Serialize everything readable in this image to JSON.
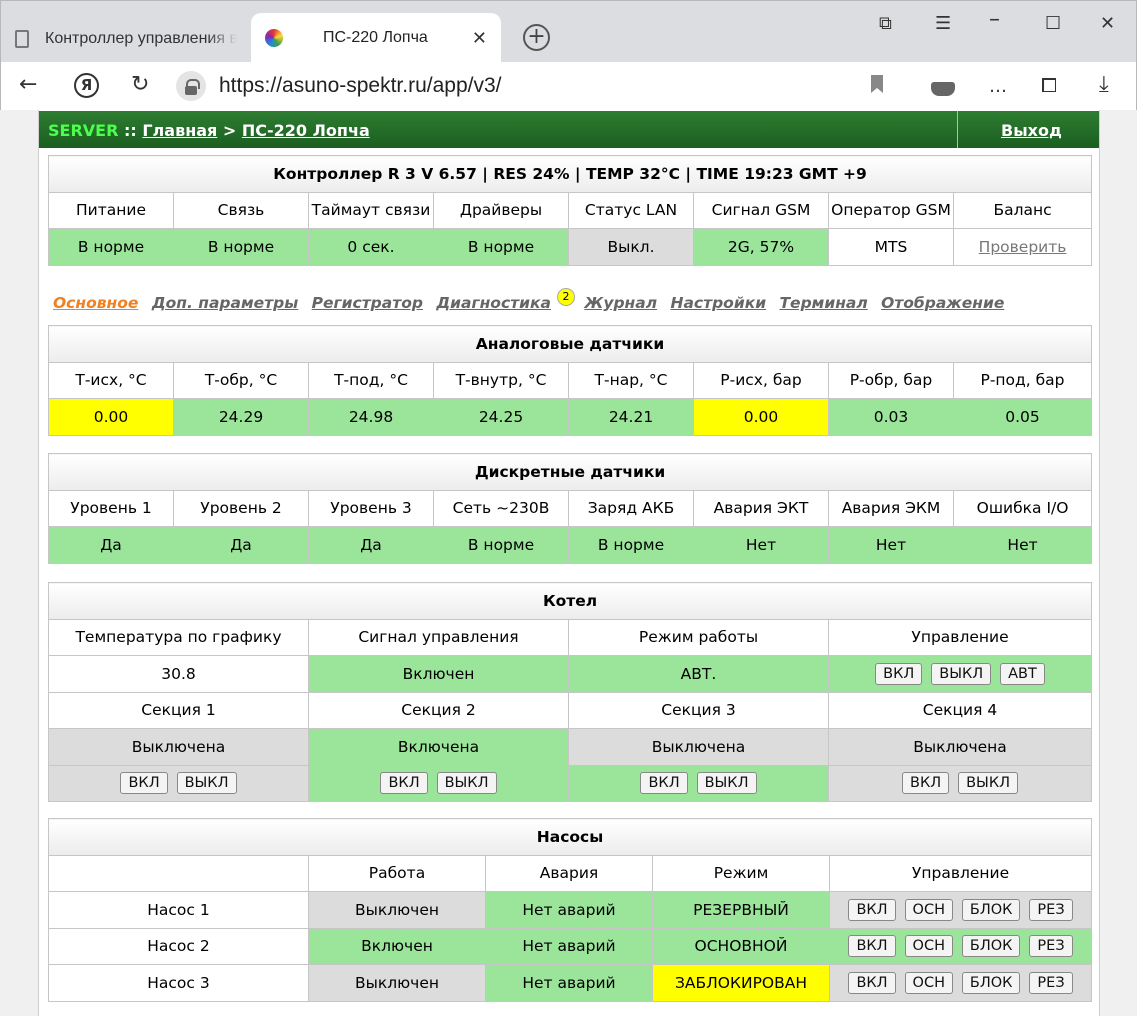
{
  "browser": {
    "tab_inactive_title": "Контроллер управления в",
    "tab_active_title": "ПС-220 Лопча",
    "url": "https://asuno-spektr.ru/app/v3/"
  },
  "nav": {
    "server": "SERVER",
    "separator": "::",
    "home": "Главная",
    "arrow": ">",
    "object": "ПС-220 Лопча",
    "logout": "Выход"
  },
  "controller": {
    "header": "Контроллер R 3 V 6.57 | RES 24% | TEMP 32°C | TIME 19:23 GMT +9",
    "columns": [
      "Питание",
      "Связь",
      "Таймаут связи",
      "Драйверы",
      "Статус LAN",
      "Сигнал GSM",
      "Оператор GSM",
      "Баланс"
    ],
    "values": [
      "В норме",
      "В норме",
      "0 сек.",
      "В норме",
      "Выкл.",
      "2G, 57%",
      "MTS",
      "Проверить"
    ]
  },
  "tabs": [
    {
      "label": "Основное"
    },
    {
      "label": "Доп. параметры"
    },
    {
      "label": "Регистратор"
    },
    {
      "label": "Диагностика",
      "badge": "2"
    },
    {
      "label": "Журнал"
    },
    {
      "label": "Настройки"
    },
    {
      "label": "Терминал"
    },
    {
      "label": "Отображение"
    }
  ],
  "analog": {
    "title": "Аналоговые датчики",
    "columns": [
      "Т-исх, °С",
      "Т-обр, °С",
      "Т-под, °С",
      "Т-внутр, °С",
      "Т-нар, °С",
      "Р-исх, бар",
      "Р-обр, бар",
      "Р-под, бар"
    ],
    "values": [
      "0.00",
      "24.29",
      "24.98",
      "24.25",
      "24.21",
      "0.00",
      "0.03",
      "0.05"
    ]
  },
  "discrete": {
    "title": "Дискретные датчики",
    "columns": [
      "Уровень 1",
      "Уровень 2",
      "Уровень 3",
      "Сеть ~230В",
      "Заряд АКБ",
      "Авария ЭКТ",
      "Авария ЭКМ",
      "Ошибка I/O"
    ],
    "values": [
      "Да",
      "Да",
      "Да",
      "В норме",
      "В норме",
      "Нет",
      "Нет",
      "Нет"
    ]
  },
  "boiler": {
    "title": "Котел",
    "columns": [
      "Температура по графику",
      "Сигнал управления",
      "Режим работы",
      "Управление"
    ],
    "values": [
      "30.8",
      "Включен",
      "АВТ."
    ],
    "buttons": [
      "ВКЛ",
      "ВЫКЛ",
      "АВТ"
    ],
    "sections": [
      "Секция 1",
      "Секция 2",
      "Секция 3",
      "Секция 4"
    ],
    "section_states": [
      "Выключена",
      "Включена",
      "Выключена",
      "Выключена"
    ],
    "section_buttons": [
      "ВКЛ",
      "ВЫКЛ"
    ]
  },
  "pumps": {
    "title": "Насосы",
    "columns": [
      "",
      "Работа",
      "Авария",
      "Режим",
      "Управление"
    ],
    "rows": [
      {
        "name": "Насос 1",
        "work": "Выключен",
        "alarm": "Нет аварий",
        "mode": "РЕЗЕРВНЫЙ"
      },
      {
        "name": "Насос 2",
        "work": "Включен",
        "alarm": "Нет аварий",
        "mode": "ОСНОВНОЙ"
      },
      {
        "name": "Насос 3",
        "work": "Выключен",
        "alarm": "Нет аварий",
        "mode": "ЗАБЛОКИРОВАН"
      }
    ],
    "buttons": [
      "ВКЛ",
      "ОСН",
      "БЛОК",
      "РЕЗ"
    ]
  }
}
